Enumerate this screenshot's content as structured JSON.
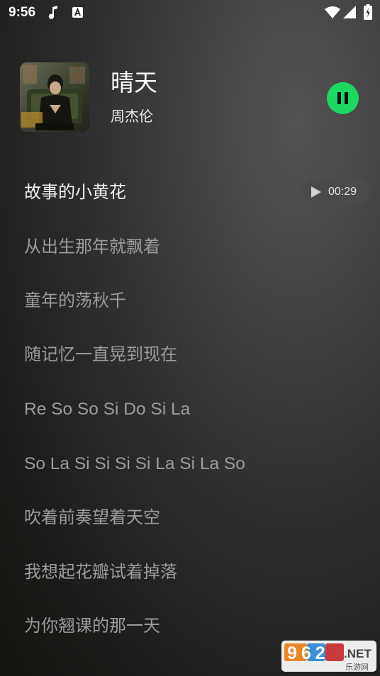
{
  "status_bar": {
    "time": "9:56"
  },
  "now_playing": {
    "title": "晴天",
    "artist": "周杰伦",
    "accent_color": "#1ed760",
    "state": "playing"
  },
  "lyrics": {
    "current_time": "00:29",
    "lines": [
      "故事的小黄花",
      "从出生那年就飘着",
      "童年的荡秋千",
      "随记忆一直晃到现在",
      "Re So So Si Do Si La",
      "So La Si Si Si Si La Si La So",
      "吹着前奏望着天空",
      "我想起花瓣试着掉落",
      "为你翘课的那一天"
    ]
  },
  "watermark": {
    "number": "962",
    "suffix": ".NET",
    "subtitle": "乐游网"
  }
}
